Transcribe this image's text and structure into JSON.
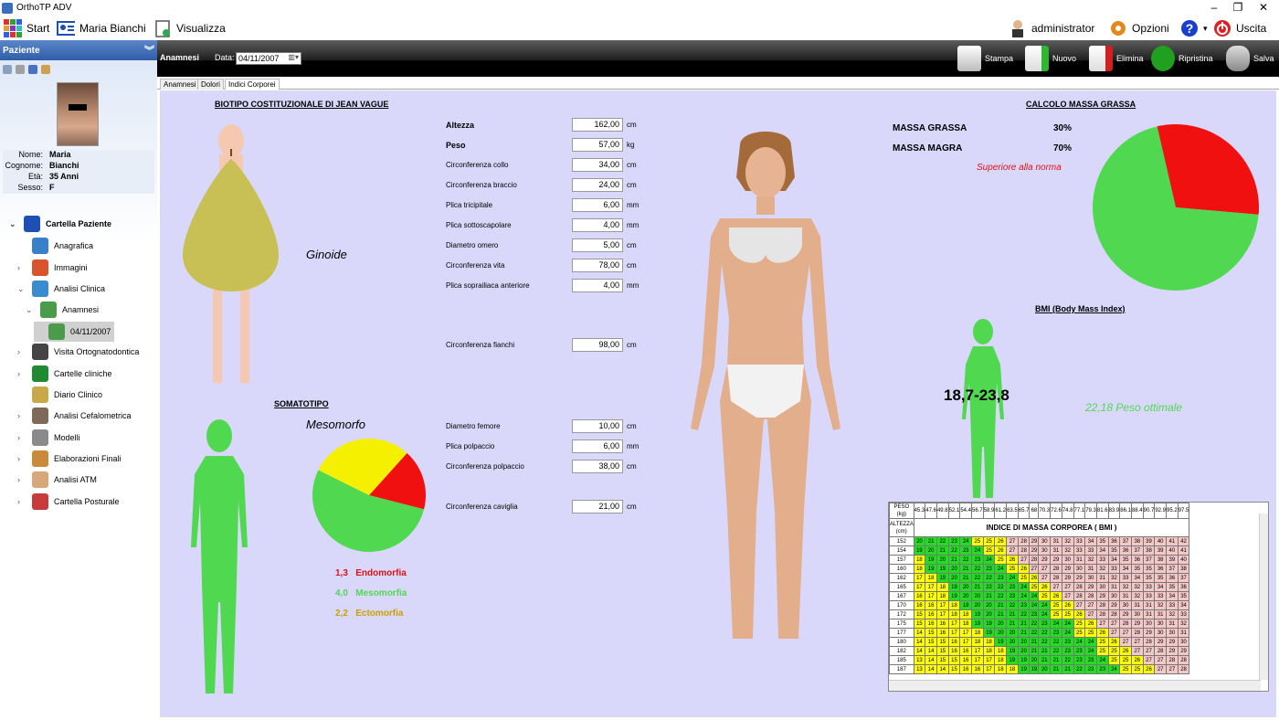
{
  "window": {
    "title": "OrthoTP  ADV",
    "min": "–",
    "restore": "❐",
    "close": "✕"
  },
  "menu": {
    "start": "Start",
    "patient": "Maria Bianchi",
    "view": "Visualizza",
    "admin": "administrator",
    "options": "Opzioni",
    "exit": "Uscita",
    "help_dropdown": "▾"
  },
  "left": {
    "header": "Paziente",
    "info": [
      {
        "k": "Nome:",
        "v": "Maria"
      },
      {
        "k": "Cognome:",
        "v": "Bianchi"
      },
      {
        "k": "Età:",
        "v": "35 Anni"
      },
      {
        "k": "Sesso:",
        "v": "F"
      }
    ],
    "tree": [
      {
        "label": "Cartella Paziente",
        "exp": "⌄",
        "color": "#1e4fb5"
      },
      {
        "label": "Anagrafica",
        "exp": "",
        "color": "#3a80c9"
      },
      {
        "label": "Immagini",
        "exp": "›",
        "color": "#d9542d"
      },
      {
        "label": "Analisi Clinica",
        "exp": "⌄",
        "color": "#3b8bd1"
      },
      {
        "label": "Anamnesi",
        "exp": "⌄",
        "color": "#4a9b4a"
      },
      {
        "label": "04/11/2007",
        "exp": "",
        "color": "#4a9b4a"
      },
      {
        "label": "Visita Ortognatodontica",
        "exp": "›",
        "color": "#444"
      },
      {
        "label": "Cartelle cliniche",
        "exp": "›",
        "color": "#1f8a2f"
      },
      {
        "label": "Diario Clinico",
        "exp": "",
        "color": "#c9a84a"
      },
      {
        "label": "Analisi Cefalometrica",
        "exp": "›",
        "color": "#7f6a5a"
      },
      {
        "label": "Modelli",
        "exp": "›",
        "color": "#8a8a8a"
      },
      {
        "label": "Elaborazioni Finali",
        "exp": "›",
        "color": "#c98a3a"
      },
      {
        "label": "Analisi ATM",
        "exp": "›",
        "color": "#d9a87a"
      },
      {
        "label": "Cartella Posturale",
        "exp": "›",
        "color": "#c93a3a"
      }
    ]
  },
  "toolbar": {
    "section": "Anamnesi",
    "date_label": "Data:",
    "date": "04/11/2007",
    "print": "Stampa",
    "new": "Nuovo",
    "delete": "Elimina",
    "restore": "Ripristina",
    "save": "Salva"
  },
  "tabs": [
    "Anamnesi",
    "Dolori",
    "Indici Corporei"
  ],
  "biotipo": {
    "title": "BIOTIPO COSTITUZIONALE DI JEAN VAGUE",
    "type": "Ginoide"
  },
  "somatotipo": {
    "title": "SOMATOTIPO",
    "type": "Mesomorfo",
    "values": [
      {
        "v": "1,3",
        "name": "Endomorfia",
        "color": "#e01010"
      },
      {
        "v": "4,0",
        "name": "Mesomorfia",
        "color": "#50d850"
      },
      {
        "v": "2,2",
        "name": "Ectomorfia",
        "color": "#c9a000"
      }
    ]
  },
  "fields_top": [
    {
      "label": "Altezza",
      "value": "162,00",
      "unit": "cm",
      "bold": true
    },
    {
      "label": "Peso",
      "value": "57,00",
      "unit": "kg",
      "bold": true
    },
    {
      "label": "Circonferenza collo",
      "value": "34,00",
      "unit": "cm"
    },
    {
      "label": "Circonferenza braccio",
      "value": "24,00",
      "unit": "cm"
    },
    {
      "label": "Plica tricipitale",
      "value": "6,00",
      "unit": "mm"
    },
    {
      "label": "Plica sottoscapolare",
      "value": "4,00",
      "unit": "mm"
    },
    {
      "label": "Diametro omero",
      "value": "5,00",
      "unit": "cm"
    },
    {
      "label": "Circonferenza vita",
      "value": "78,00",
      "unit": "cm"
    },
    {
      "label": "Plica soprailiaca anteriore",
      "value": "4,00",
      "unit": "mm"
    }
  ],
  "field_hips": {
    "label": "Circonferenza fianchi",
    "value": "98,00",
    "unit": "cm"
  },
  "fields_bottom": [
    {
      "label": "Diametro femore",
      "value": "10,00",
      "unit": "cm"
    },
    {
      "label": "Plica polpaccio",
      "value": "6,00",
      "unit": "mm"
    },
    {
      "label": "Circonferenza polpaccio",
      "value": "38,00",
      "unit": "cm"
    }
  ],
  "field_ankle": {
    "label": "Circonferenza caviglia",
    "value": "21,00",
    "unit": "cm"
  },
  "massa": {
    "title": "CALCOLO MASSA GRASSA",
    "grassa_label": "MASSA GRASSA",
    "grassa": "30%",
    "magra_label": "MASSA MAGRA",
    "magra": "70%",
    "note": "Superiore alla norma"
  },
  "bmi": {
    "title": "BMI (Body Mass Index)",
    "range": "18,7-23,8",
    "value_text": "22,18 Peso ottimale",
    "table_title": "INDICE DI MASSA CORPOREA  ( BMI )",
    "peso_label": "PESO (kg)",
    "alt_label": "ALTEZZA (cm)"
  },
  "chart_data": [
    {
      "type": "pie",
      "title": "",
      "categories": [
        "Endomorfia",
        "Mesomorfia",
        "Ectomorfia"
      ],
      "values": [
        1.3,
        4.0,
        2.2
      ],
      "colors": [
        "#f01010",
        "#50d850",
        "#f5f000"
      ]
    },
    {
      "type": "pie",
      "title": "",
      "categories": [
        "MASSA GRASSA",
        "MASSA MAGRA"
      ],
      "values": [
        30,
        70
      ],
      "colors": [
        "#f01010",
        "#50d850"
      ]
    }
  ]
}
